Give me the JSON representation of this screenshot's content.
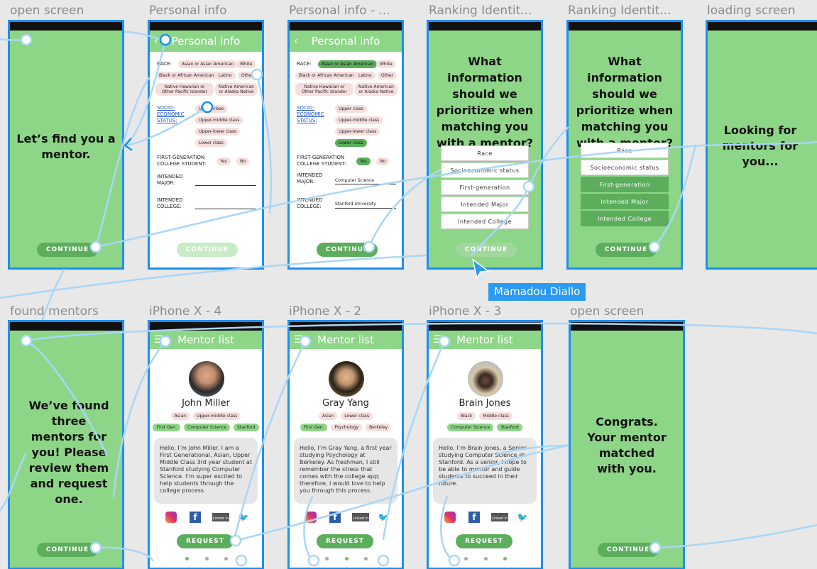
{
  "frame_labels": {
    "f1": "open screen",
    "f2": "Personal info",
    "f3": "Personal info - ...",
    "f4": "Ranking Identit...",
    "f5": "Ranking Identit...",
    "f6": "loading screen",
    "f7": "found mentors",
    "f8": "iPhone X - 4",
    "f9": "iPhone X - 2",
    "f10": "iPhone X - 3",
    "f11": "open screen"
  },
  "open_screen": {
    "text": "Let’s find you a mentor.",
    "button": "CONTINUE"
  },
  "personal_info": {
    "title": "Personal info",
    "back": "‹",
    "race_label": "RACE:",
    "race_options": [
      "Asian or Asian American",
      "White",
      "Black or African American",
      "Latino",
      "Other",
      "Native Hawaiian or Other Pacific Islander",
      "Native American or Alaska Native"
    ],
    "ses_label": "SOCIO-ECONOMIC STATUS:",
    "ses_options": [
      "Upper class",
      "Upper-middle class",
      "Upper-lower class",
      "Lower class"
    ],
    "firstgen_label": "FIRST-GENERATION COLLEGE STUDENT:",
    "yes": "Yes",
    "no": "No",
    "major_label": "INTENDED MAJOR:",
    "college_label": "INTENDED COLLEGE:",
    "button": "CONTINUE"
  },
  "personal_info_filled": {
    "major_value": "Computer Science",
    "college_value": "Stanford University"
  },
  "ranking": {
    "question": "What information should we prioritize when matching you with a mentor?",
    "options": [
      "Race",
      "Socioeconomic status",
      "First-generation",
      "Intended Major",
      "Intended College"
    ],
    "button": "CONTINUE"
  },
  "loading": {
    "text": "Looking for mentors for you..."
  },
  "found": {
    "text": "We’ve found three mentors for you! Please review them and request one.",
    "button": "CONTINUE"
  },
  "mentor_list_title": "Mentor list",
  "mentors": [
    {
      "name": "John Miller",
      "tags1": [
        "Asian",
        "Upper-middle class"
      ],
      "tags2": [
        "First Gen.",
        "Computer Science",
        "Stanford"
      ],
      "bio": "Hello, I’m John Miller. I am a First Generational, Asian, Upper Middle Class 3rd year student at Stanford studying Computer Science. I’m super excited to help students through the college process."
    },
    {
      "name": "Gray Yang",
      "tags1": [
        "Asian",
        "Lower class"
      ],
      "tags2": [
        "First Gen.",
        "Psychology",
        "Berkeley"
      ],
      "bio": "Hello, I’m Gray Yang, a first year studying Psychology at Berkeley. As freshman, I still remember the stress that comes with the college app; therefore, I would love to help you through this process."
    },
    {
      "name": "Brain Jones",
      "tags1": [
        "Black",
        "Middle class"
      ],
      "tags2": [
        "Computer Science",
        "Stanford"
      ],
      "bio": "Hello, I’m Brain Jones, a Senior studying Computer Science at Stanford. As a senior, I hope to be able to mentor and guide students to succeed in their future."
    }
  ],
  "social": {
    "linkedin": "Linked in",
    "fb": "f",
    "tw": "🐦"
  },
  "request_button": "REQUEST",
  "congrats": {
    "text": "Congrats. Your mentor matched with you.",
    "button": "CONTINUE"
  },
  "collaborator": {
    "name": "Mamadou Diallo",
    "color": "#2b9af3"
  },
  "colors": {
    "accent": "#8ed687",
    "dark_green": "#5cad5c",
    "frame_border": "#1c8ff0",
    "canvas": "#e8e8e8"
  }
}
